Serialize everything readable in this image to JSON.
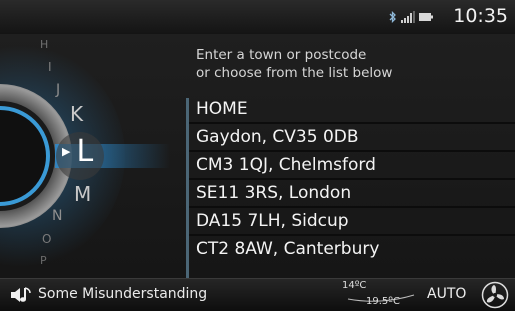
{
  "status": {
    "time": "10:35",
    "icons": [
      "bluetooth-icon",
      "signal-bars-icon",
      "battery-icon"
    ]
  },
  "dial": {
    "letters_above": [
      "H",
      "I",
      "J"
    ],
    "letter_prev": "K",
    "letter_selected": "L",
    "letter_next": "M",
    "letters_below": [
      "N",
      "O",
      "P"
    ],
    "accent_color": "#3a9ad6"
  },
  "instruction": {
    "line1": "Enter a town or postcode",
    "line2": "or choose from the list below"
  },
  "destinations": [
    {
      "label": "HOME"
    },
    {
      "label": "Gaydon, CV35 0DB"
    },
    {
      "label": "CM3 1QJ, Chelmsford"
    },
    {
      "label": "SE11 3RS, London"
    },
    {
      "label": "DA15 7LH, Sidcup"
    },
    {
      "label": "CT2 8AW, Canterbury"
    }
  ],
  "bottom": {
    "now_playing": "Some Misunderstanding",
    "temp_outside": "14ºC",
    "temp_set": "19.5ºC",
    "climate_mode": "AUTO",
    "icons": [
      "music-note-icon",
      "fan-icon"
    ]
  }
}
